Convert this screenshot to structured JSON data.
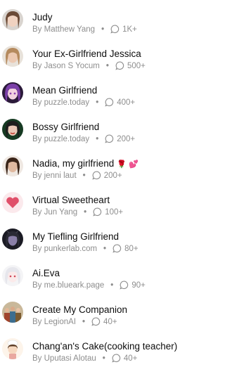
{
  "items": [
    {
      "title": "Judy",
      "author": "By Matthew Yang",
      "count": "1K+",
      "avatar": "woman-portrait-icon"
    },
    {
      "title": "Your Ex-Girlfriend Jessica",
      "author": "By Jason S Yocum",
      "count": "500+",
      "avatar": "woman-portrait-icon"
    },
    {
      "title": "Mean Girlfriend",
      "author": "By puzzle.today",
      "count": "400+",
      "avatar": "anime-girl-icon"
    },
    {
      "title": "Bossy Girlfriend",
      "author": "By puzzle.today",
      "count": "200+",
      "avatar": "woman-portrait-icon"
    },
    {
      "title": "Nadia, my girlfriend",
      "title_emoji": "🌹 💕",
      "author": "By jenni laut",
      "count": "200+",
      "avatar": "woman-portrait-icon"
    },
    {
      "title": "Virtual Sweetheart",
      "author": "By Jun Yang",
      "count": "100+",
      "avatar": "heart-icon"
    },
    {
      "title": "My Tiefling Girlfriend",
      "author": "By punkerlab.com",
      "count": "80+",
      "avatar": "tiefling-portrait-icon"
    },
    {
      "title": "Ai.Eva",
      "author": "By me.blueark.page",
      "count": "90+",
      "avatar": "anime-girl-icon"
    },
    {
      "title": "Create My Companion",
      "author": "By LegionAI",
      "count": "40+",
      "avatar": "group-portrait-icon"
    },
    {
      "title": "Chang'an's Cake(cooking teacher)",
      "author": "By Uputasi Alotau",
      "count": "40+",
      "avatar": "chef-cartoon-icon"
    }
  ]
}
